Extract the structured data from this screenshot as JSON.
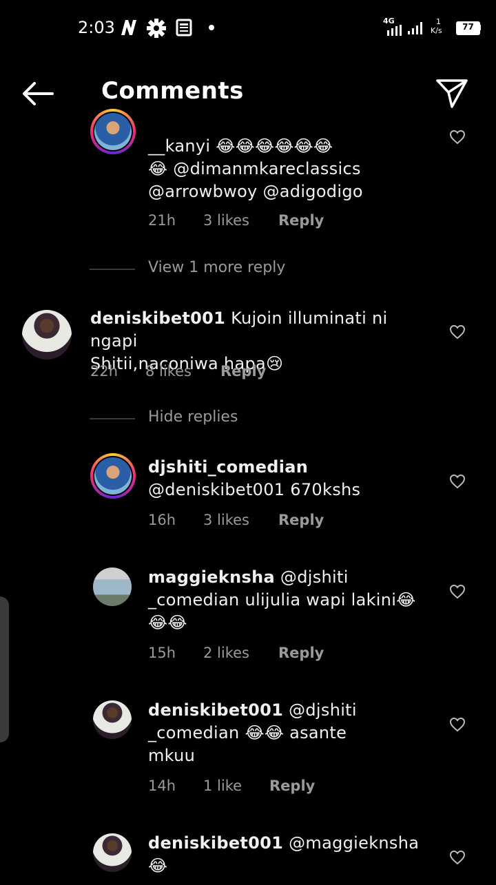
{
  "status_bar": {
    "time": "2:03",
    "network_label": "4G",
    "speed_value": "1",
    "speed_unit": "K/s",
    "battery": "77"
  },
  "header": {
    "title": "Comments"
  },
  "colors": {
    "background": "#000000",
    "text": "#f2f2f2",
    "muted": "#9a9a9a"
  },
  "comments": [
    {
      "text_lines": [
        "__kanyi 😂😂😂😂😂😂",
        "😂 @dimanmkareclassics",
        "@arrowbwoy @adigodigo"
      ],
      "time": "21h",
      "likes": "3 likes",
      "reply": "Reply"
    },
    {
      "username": "deniskibet001",
      "line1_rest": " Kujoin illuminati ni ngapi",
      "line2": "Shitii,naconiwa hapa😢",
      "time": "22h",
      "likes": "8 likes",
      "reply": "Reply"
    },
    {
      "username": "djshiti_comedian",
      "line2": "@deniskibet001 670kshs",
      "time": "16h",
      "likes": "3 likes",
      "reply": "Reply"
    },
    {
      "username": "maggieknsha",
      "line1_rest": " @djshiti",
      "line2": "_comedian ulijulia wapi lakini😂",
      "line3": "😂😂",
      "time": "15h",
      "likes": "2 likes",
      "reply": "Reply"
    },
    {
      "username": "deniskibet001",
      "line1_rest": " @djshiti",
      "line2": "_comedian 😂😂 asante",
      "line3": "mkuu",
      "time": "14h",
      "likes": "1 like",
      "reply": "Reply"
    },
    {
      "username": "deniskibet001",
      "line1_rest": " @maggieknsha",
      "line2": "😂"
    }
  ],
  "view_more": "View 1 more reply",
  "hide_replies": "Hide replies"
}
